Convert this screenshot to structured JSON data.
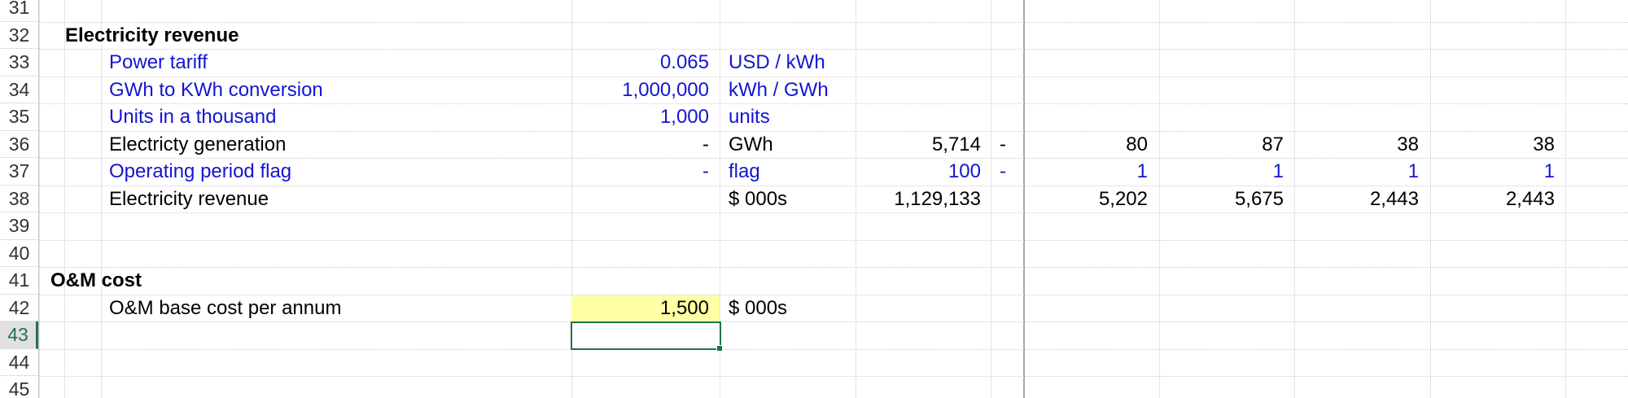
{
  "rows": [
    {
      "num": "31"
    },
    {
      "num": "32",
      "label": "Electricity revenue",
      "label_style": "bold"
    },
    {
      "num": "33",
      "label": "Power tariff",
      "style": "blue",
      "value": "0.065",
      "unit": "USD / kWh"
    },
    {
      "num": "34",
      "label": "GWh to KWh conversion",
      "style": "blue",
      "value": "1,000,000",
      "unit": "kWh / GWh"
    },
    {
      "num": "35",
      "label": "Units in a thousand",
      "style": "blue",
      "value": "1,000",
      "unit": "units"
    },
    {
      "num": "36",
      "label": "Electricty generation",
      "style": "black",
      "value": "-",
      "unit": "GWh",
      "total": "5,714",
      "dash": "-",
      "periods": [
        "80",
        "87",
        "38",
        "38"
      ]
    },
    {
      "num": "37",
      "label": "Operating period flag",
      "style": "blue",
      "value": "-",
      "unit": "flag",
      "total": "100",
      "dash": "-",
      "periods": [
        "1",
        "1",
        "1",
        "1"
      ]
    },
    {
      "num": "38",
      "label": "Electricity revenue",
      "style": "black",
      "unit": "$ 000s",
      "total": "1,129,133",
      "periods": [
        "5,202",
        "5,675",
        "2,443",
        "2,443"
      ]
    },
    {
      "num": "39"
    },
    {
      "num": "40"
    },
    {
      "num": "41",
      "label": "O&M cost",
      "label_style": "bold-section"
    },
    {
      "num": "42",
      "label": "O&M base cost per annum",
      "style": "black",
      "value": "1,500",
      "unit": "$ 000s",
      "input": true
    },
    {
      "num": "43",
      "active": true
    },
    {
      "num": "44"
    },
    {
      "num": "45"
    }
  ],
  "colors": {
    "input_blue": "#1414d2",
    "input_fill": "#ffffa6",
    "selection_green": "#217346"
  }
}
